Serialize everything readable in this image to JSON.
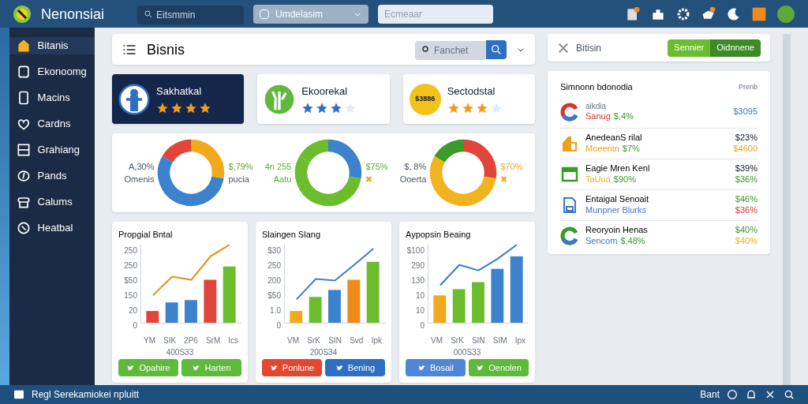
{
  "app": {
    "name": "Nenonsiai"
  },
  "topbar": {
    "search_placeholder": "Eitsmmin",
    "dropdown": "Umdelasim",
    "field_placeholder": "Ecmeaar"
  },
  "sidebar": {
    "items": [
      {
        "label": "Bitanis",
        "selected": true
      },
      {
        "label": "Ekonoomg",
        "selected": false
      },
      {
        "label": "Macins",
        "selected": false
      },
      {
        "label": "Cardns",
        "selected": false
      },
      {
        "label": "Grahiang",
        "selected": false
      },
      {
        "label": "Pands",
        "selected": false
      },
      {
        "label": "Calums",
        "selected": false
      },
      {
        "label": "Heatbal",
        "selected": false
      }
    ]
  },
  "header": {
    "title": "Bisnis",
    "search_placeholder": "Fanchet"
  },
  "profiles": [
    {
      "name": "Sakhatkal",
      "stars": 4,
      "dark": true
    },
    {
      "name": "Ekoorekal",
      "stars": 3,
      "dark": false
    },
    {
      "name": "Sectodstal",
      "stars": 3,
      "dark": false,
      "badge": "$3886"
    }
  ],
  "donuts": [
    {
      "left_top": "A,30%",
      "left_bottom": "Omenis",
      "right_top": "$,79%",
      "right_bottom": "pucia"
    },
    {
      "left_top": "4n 255",
      "left_bottom": "Aatu",
      "right_top": "$75%",
      "right_bottom": "✖"
    },
    {
      "left_top": "$, 8%",
      "left_bottom": "Ooerta",
      "right_top": "$70%",
      "right_bottom": "✖"
    }
  ],
  "charts": [
    {
      "title": "Propgial Bntal",
      "yticks": [
        "250",
        "250",
        "$50",
        "150",
        "20",
        "0"
      ],
      "xlabels": [
        "YM",
        "SIK",
        "2P6",
        "SrM",
        "Ics"
      ],
      "caption": "400S33",
      "buttons": [
        {
          "label": "Opahire",
          "color": "#5fb93c"
        },
        {
          "label": "Harten",
          "color": "#5fb93c"
        }
      ]
    },
    {
      "title": "Slaingen Slang",
      "yticks": [
        "$30",
        "250",
        "200",
        "$50",
        "1.0",
        "0"
      ],
      "xlabels": [
        "VM",
        "SrK",
        "SIN",
        "Svd",
        "Ipk"
      ],
      "caption": "200S34",
      "buttons": [
        {
          "label": "Ponlune",
          "color": "#e4472f"
        },
        {
          "label": "Bening",
          "color": "#2f6fc2"
        }
      ]
    },
    {
      "title": "Aypopsin Beaing",
      "yticks": [
        "$100",
        "290",
        "130",
        "10",
        "10",
        "0"
      ],
      "xlabels": [
        "VM",
        "SrK",
        "SIN",
        "SIM",
        "Ipx"
      ],
      "caption": "000S33",
      "buttons": [
        {
          "label": "Bosail",
          "color": "#4f86d6"
        },
        {
          "label": "Oenolen",
          "color": "#5fb93c"
        }
      ]
    }
  ],
  "right_header": {
    "title": "Bitisin",
    "tabs": [
      {
        "label": "Sennier",
        "selected": false
      },
      {
        "label": "Oidnnene",
        "selected": true
      }
    ]
  },
  "list": {
    "title": "Simnonn bdonodia",
    "column": "Prenb",
    "rows": [
      {
        "caption": "aikdia",
        "name": "Sanug",
        "amount": "$,4%",
        "value1": "$3095",
        "color": "#d9342b"
      },
      {
        "name": "AnedeanS rilal",
        "sub": "Moeentn",
        "amount": "$7%",
        "value1": "$23%",
        "value2": "$4600",
        "color": "#f0a020"
      },
      {
        "name": "Eagie Mren Kenl",
        "sub": "TaUua",
        "amount": "$90%",
        "value1": "$39%",
        "value2": "$36%",
        "color": "#f0b020"
      },
      {
        "name": "Entaigal Senoait",
        "sub": "Munpner Blurks",
        "value1": "$46%",
        "value2": "$36%",
        "color": "#3d78c7"
      },
      {
        "name": "Reoryoin Henas",
        "sub": "Sencom",
        "amount": "$,48%",
        "value1": "$40%",
        "value2": "$40%",
        "color": "#3d78c7"
      }
    ]
  },
  "status_bar": {
    "text": "Regl Serekamiokei npluitt",
    "right": "Bant"
  }
}
